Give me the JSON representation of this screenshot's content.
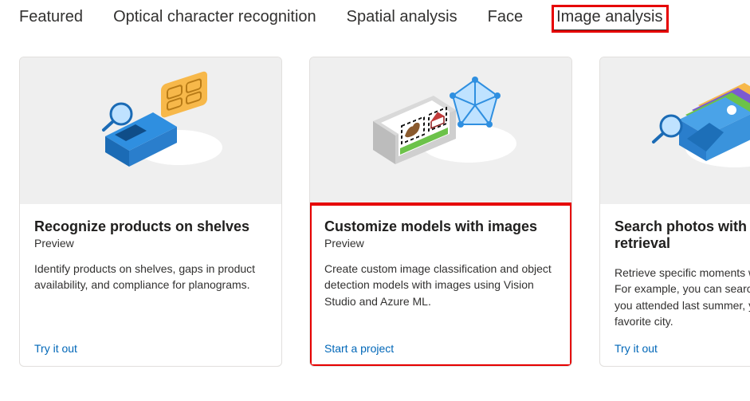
{
  "tabs": [
    {
      "label": "Featured"
    },
    {
      "label": "Optical character recognition"
    },
    {
      "label": "Spatial analysis"
    },
    {
      "label": "Face"
    },
    {
      "label": "Image analysis",
      "active": true,
      "highlighted": true
    }
  ],
  "cards": [
    {
      "title": "Recognize products on shelves",
      "subtitle": "Preview",
      "desc": "Identify products on shelves, gaps in product availability, and compliance for planograms.",
      "link_label": "Try it out",
      "highlighted": false
    },
    {
      "title": "Customize models with images",
      "subtitle": "Preview",
      "desc": "Create custom image classification and object detection models with images using Vision Studio and Azure ML.",
      "link_label": "Start a project",
      "highlighted": true
    },
    {
      "title": "Search photos with image retrieval",
      "subtitle": "",
      "desc": "Retrieve specific moments within your album. For example, you can search for a wedding you attended last summer, your pet, or your favorite city.",
      "link_label": "Try it out",
      "highlighted": false
    }
  ]
}
